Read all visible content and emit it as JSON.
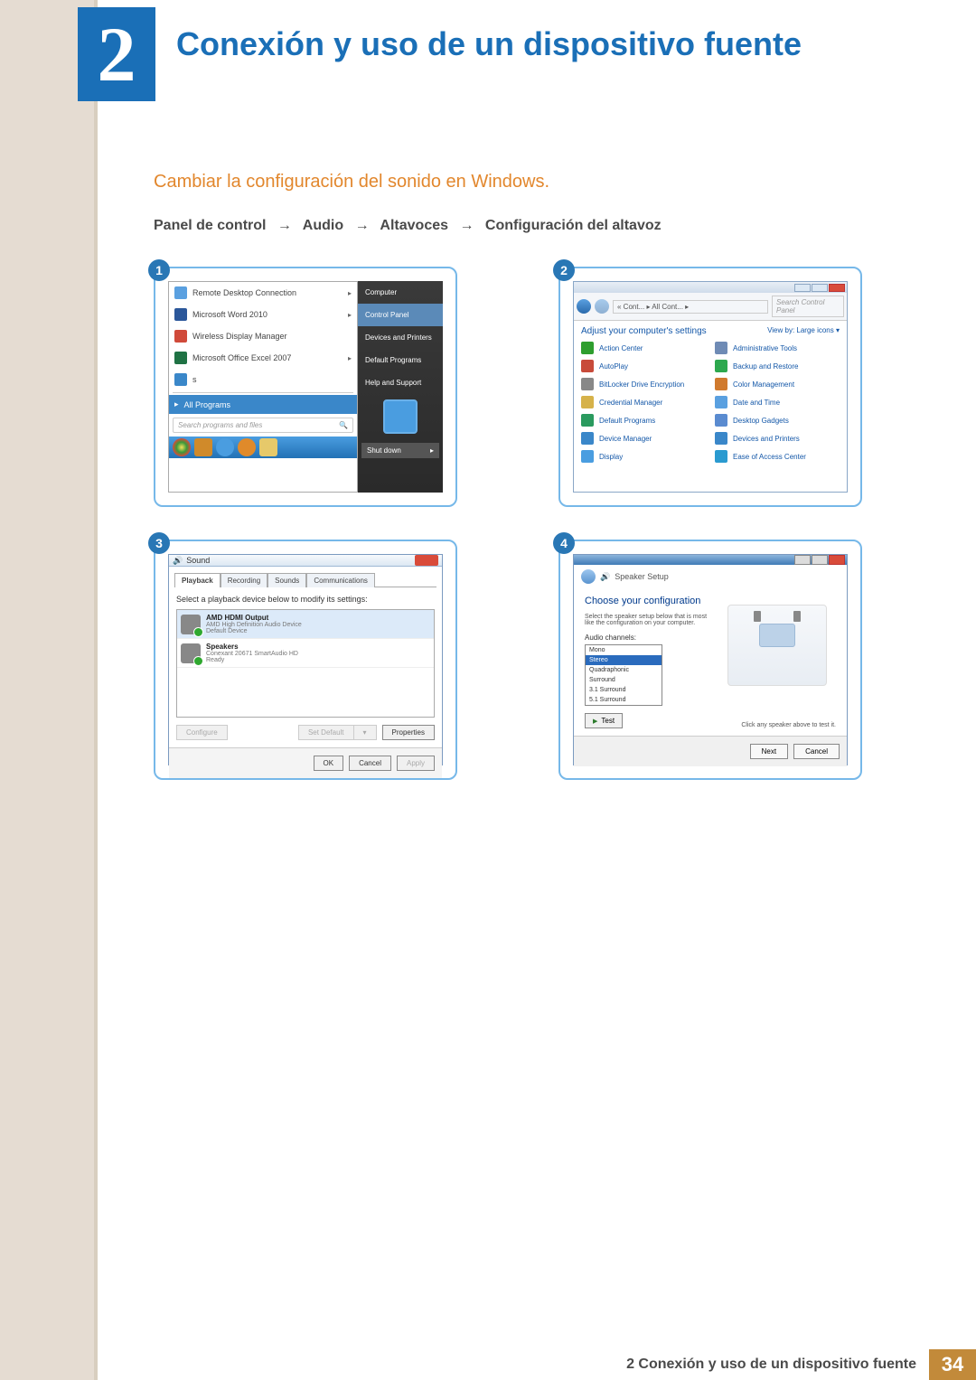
{
  "chapter": {
    "number": "2",
    "title": "Conexión y uso de un dispositivo fuente"
  },
  "section": {
    "heading": "Cambiar la configuración del sonido en Windows."
  },
  "breadcrumb": {
    "p0": "Panel de control",
    "p1": "Audio",
    "p2": "Altavoces",
    "p3": "Configuración del altavoz",
    "arrow": "→"
  },
  "step1": {
    "items": [
      {
        "text": "Remote Desktop Connection",
        "iconColor": "#5aa0e0",
        "chevron": true
      },
      {
        "text": "Microsoft Word 2010",
        "iconColor": "#2b579a",
        "chevron": true
      },
      {
        "text": "Wireless Display Manager",
        "iconColor": "#d04a3a",
        "chevron": false
      },
      {
        "text": "Microsoft Office Excel 2007",
        "iconColor": "#1f7244",
        "chevron": true
      },
      {
        "text": "s",
        "iconColor": "#3a87c9",
        "chevron": false
      }
    ],
    "allPrograms": "All Programs",
    "search": "Search programs and files",
    "right": [
      "Computer",
      "Control Panel",
      "Devices and Printers",
      "Default Programs",
      "Help and Support"
    ],
    "shutdown": "Shut down"
  },
  "step2": {
    "addr": "« Cont... ▸ All Cont... ▸",
    "search": "Search Control Panel",
    "header": "Adjust your computer's settings",
    "viewby": "View by:   Large icons ▾",
    "items": [
      {
        "t": "Action Center",
        "c": "#2e9e2e"
      },
      {
        "t": "Administrative Tools",
        "c": "#6f8bb5"
      },
      {
        "t": "AutoPlay",
        "c": "#c84b3a"
      },
      {
        "t": "Backup and Restore",
        "c": "#2da84e"
      },
      {
        "t": "BitLocker Drive Encryption",
        "c": "#888"
      },
      {
        "t": "Color Management",
        "c": "#d07a2e"
      },
      {
        "t": "Credential Manager",
        "c": "#d6b24a"
      },
      {
        "t": "Date and Time",
        "c": "#5aa0e0"
      },
      {
        "t": "Default Programs",
        "c": "#2a9a5e"
      },
      {
        "t": "Desktop Gadgets",
        "c": "#5a8bd0"
      },
      {
        "t": "Device Manager",
        "c": "#3a87c9"
      },
      {
        "t": "Devices and Printers",
        "c": "#3a87c9"
      },
      {
        "t": "Display",
        "c": "#4a9de0"
      },
      {
        "t": "Ease of Access Center",
        "c": "#2a9ad0"
      }
    ]
  },
  "step3": {
    "title": "Sound",
    "tabs": [
      "Playback",
      "Recording",
      "Sounds",
      "Communications"
    ],
    "label": "Select a playback device below to modify its settings:",
    "devices": [
      {
        "name": "AMD HDMI Output",
        "sub1": "AMD High Definition Audio Device",
        "sub2": "Default Device"
      },
      {
        "name": "Speakers",
        "sub1": "Conexant 20671 SmartAudio HD",
        "sub2": "Ready"
      }
    ],
    "configure": "Configure",
    "setDefault": "Set Default",
    "dd": "▾",
    "properties": "Properties",
    "ok": "OK",
    "cancel": "Cancel",
    "apply": "Apply"
  },
  "step4": {
    "crumb": "Speaker Setup",
    "title": "Choose your configuration",
    "sub": "Select the speaker setup below that is most like the configuration on your computer.",
    "label": "Audio channels:",
    "options": [
      "Mono",
      "Stereo",
      "Quadraphonic",
      "Surround",
      "3.1 Surround",
      "5.1 Surround",
      "5.1 Surround"
    ],
    "selected": 1,
    "test": "Test",
    "hint": "Click any speaker above to test it.",
    "next": "Next",
    "cancel": "Cancel"
  },
  "footer": {
    "text": "2 Conexión y uso de un dispositivo fuente",
    "page": "34"
  }
}
